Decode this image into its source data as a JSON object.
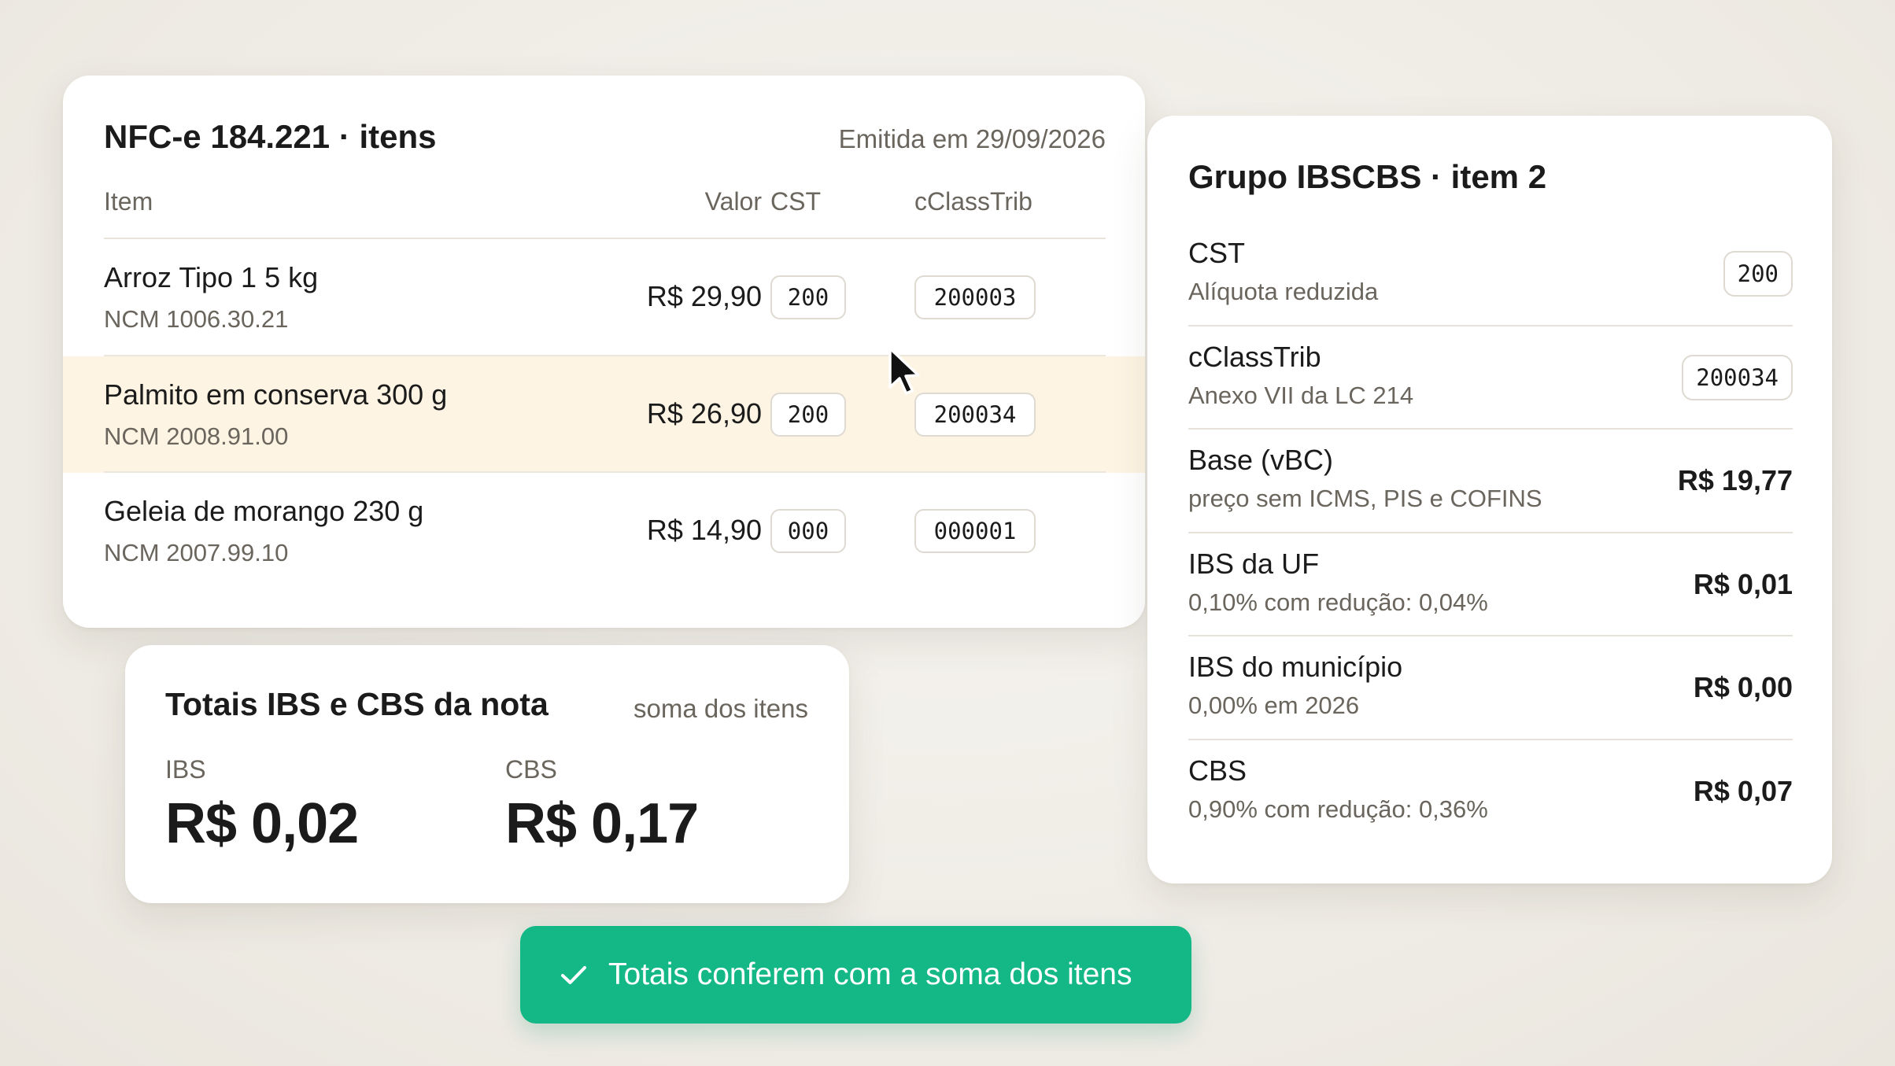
{
  "colors": {
    "background": "#eeebe4",
    "card": "#ffffff",
    "highlight_row": "#fdf4e3",
    "success": "#14b886",
    "muted_text": "#6a655d"
  },
  "items_card": {
    "title": "NFC-e 184.221 · itens",
    "issued": "Emitida em 29/09/2026",
    "columns": {
      "item": "Item",
      "valor": "Valor",
      "cst": "CST",
      "cclasstrib": "cClassTrib"
    },
    "rows": [
      {
        "name": "Arroz Tipo 1 5 kg",
        "ncm": "NCM 1006.30.21",
        "valor": "R$ 29,90",
        "cst": "200",
        "cclasstrib": "200003",
        "highlighted": false
      },
      {
        "name": "Palmito em conserva 300 g",
        "ncm": "NCM 2008.91.00",
        "valor": "R$ 26,90",
        "cst": "200",
        "cclasstrib": "200034",
        "highlighted": true
      },
      {
        "name": "Geleia de morango 230 g",
        "ncm": "NCM 2007.99.10",
        "valor": "R$ 14,90",
        "cst": "000",
        "cclasstrib": "000001",
        "highlighted": false
      }
    ]
  },
  "group_card": {
    "title": "Grupo IBSCBS · item 2",
    "rows": [
      {
        "label": "CST",
        "sub": "Alíquota reduzida",
        "chip": "200"
      },
      {
        "label": "cClassTrib",
        "sub": "Anexo VII da LC 214",
        "chip": "200034"
      },
      {
        "label": "Base (vBC)",
        "sub": "preço sem ICMS, PIS e COFINS",
        "value": "R$ 19,77"
      },
      {
        "label": "IBS da UF",
        "sub": "0,10% com redução: 0,04%",
        "value": "R$ 0,01"
      },
      {
        "label": "IBS do município",
        "sub": "0,00% em 2026",
        "value": "R$ 0,00"
      },
      {
        "label": "CBS",
        "sub": "0,90% com redução: 0,36%",
        "value": "R$ 0,07"
      }
    ]
  },
  "totals_card": {
    "title": "Totais IBS e CBS da nota",
    "note": "soma dos itens",
    "ibs_label": "IBS",
    "ibs_value": "R$ 0,02",
    "cbs_label": "CBS",
    "cbs_value": "R$ 0,17"
  },
  "toast": {
    "icon": "check-icon",
    "text": "Totais conferem com a soma dos itens"
  },
  "cursor": {
    "icon": "mouse-pointer-icon"
  }
}
